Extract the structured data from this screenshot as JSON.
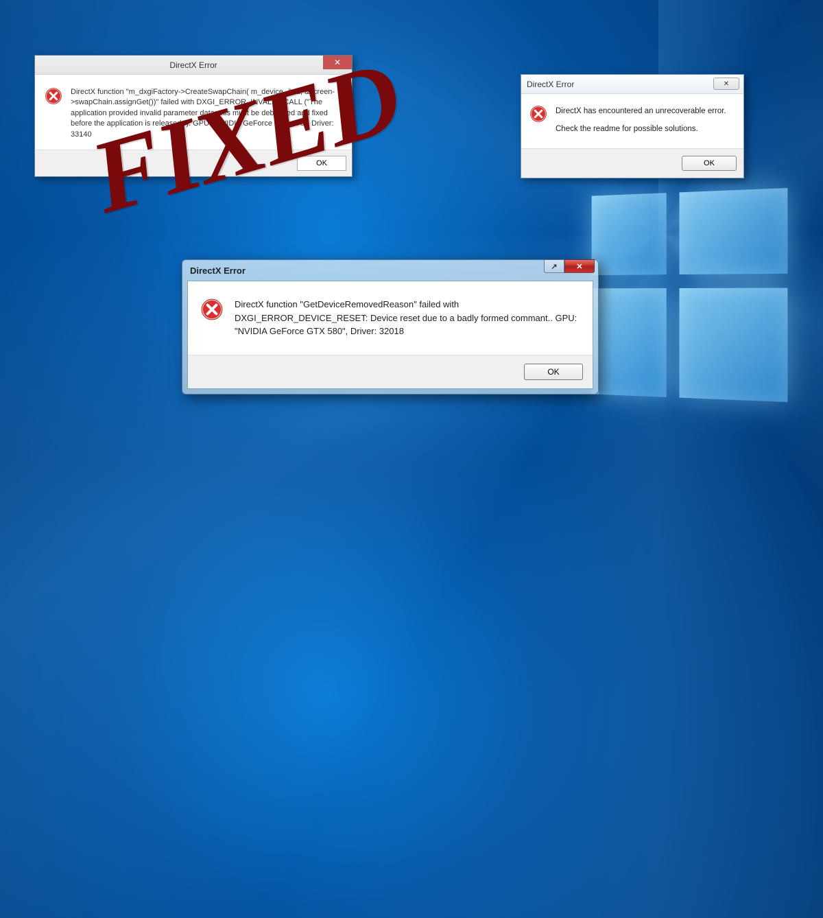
{
  "overlay": {
    "stamp_text": "FIXED"
  },
  "dialog1": {
    "title": "DirectX Error",
    "message": "DirectX function \"m_dxgiFactory->CreateSwapChain( m_device, &sd, &screen->swapChain.assignGet())\" failed with DXGI_ERROR_INVALID_CALL (\"The application provided invalid parameter data; this must be debugged and fixed before the application is released.\"). GPU: \"NVIDIA GeForce GTX 670\", Driver: 33140",
    "ok_label": "OK",
    "close_glyph": "✕"
  },
  "dialog2": {
    "title": "DirectX Error",
    "message_line1": "DirectX has encountered an unrecoverable error.",
    "message_line2": "Check the readme for possible solutions.",
    "ok_label": "OK",
    "close_glyph": "✕"
  },
  "dialog3": {
    "title": "DirectX Error",
    "message": "DirectX function \"GetDeviceRemovedReason\" failed with DXGI_ERROR_DEVICE_RESET: Device reset due to a badly formed commant.. GPU: \"NVIDIA GeForce GTX 580\", Driver: 32018",
    "ok_label": "OK",
    "help_glyph": "↗",
    "close_glyph": "✕"
  }
}
